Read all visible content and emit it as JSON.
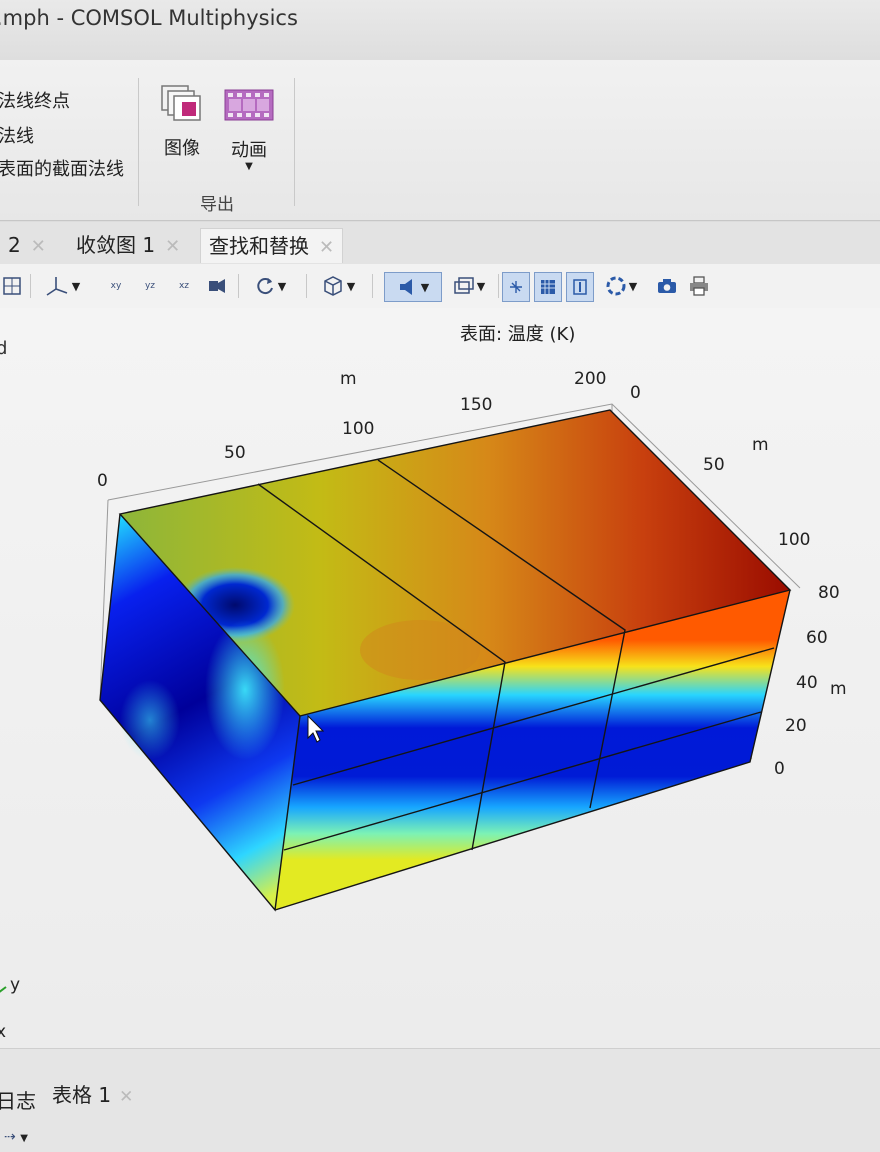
{
  "window": {
    "title": ".mph - COMSOL Multiphysics"
  },
  "ribbon": {
    "left_items": [
      "法线终点",
      "法线",
      "表面的截面法线"
    ],
    "image_button": "图像",
    "animation_button": "动画",
    "group_label": "导出"
  },
  "tabs": [
    {
      "label": "2",
      "active": false
    },
    {
      "label": "收敛图 1",
      "active": false
    },
    {
      "label": "查找和替换",
      "active": true
    }
  ],
  "toolbar": {
    "icons": [
      "zoom-extents-icon",
      "axis-orientation-icon",
      "view-xy-icon",
      "view-yz-icon",
      "view-xz-icon",
      "camera-view-icon",
      "rotate-icon",
      "view-box-icon",
      "scene-light-icon",
      "transparency-icon",
      "grid-icon",
      "render-icon",
      "axis-icon",
      "snapshot-icon",
      "screenshot-icon",
      "print-icon"
    ],
    "xy_label": "xy",
    "yz_label": "yz",
    "xz_label": "xz"
  },
  "graphics": {
    "plot_title": "表面: 温度 (K)",
    "axis_unit": "m",
    "x_ticks": [
      "0",
      "50",
      "100",
      "150",
      "200"
    ],
    "y_ticks": [
      "0",
      "50",
      "100"
    ],
    "z_ticks": [
      "0",
      "20",
      "40",
      "60",
      "80"
    ],
    "triad_y": "y",
    "triad_x": "x",
    "left_fragment": "d"
  },
  "colormap": [
    "#00008f",
    "#0000ff",
    "#00ffff",
    "#ffff00",
    "#ff0000",
    "#800000"
  ],
  "bottom_tabs": [
    {
      "label": "日志"
    },
    {
      "label": "表格 1"
    }
  ]
}
